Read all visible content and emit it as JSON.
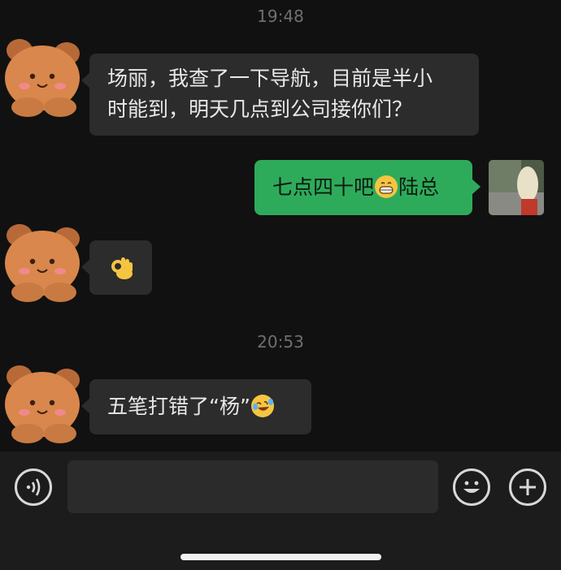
{
  "timestamps": [
    "19:48",
    "20:53"
  ],
  "messages": [
    {
      "side": "in",
      "lines": [
        "场丽，我查了一下导航，目前是半小",
        "时能到，明天几点到公司接你们？"
      ]
    },
    {
      "side": "out",
      "text_before": "七点四十吧",
      "emoji": "grinning-face",
      "text_after": "陆总"
    },
    {
      "side": "in",
      "emoji": "ok-hand"
    },
    {
      "side": "in",
      "text_before": "五笔打错了“杨”",
      "emoji": "rolling-laughing-face"
    }
  ],
  "icons": {
    "voice": "voice-icon",
    "emoji_picker": "smiley-icon",
    "more": "plus-icon",
    "avatar_contact": "teddy-bear-avatar",
    "avatar_self": "photo-avatar"
  },
  "input": {
    "value": ""
  },
  "colors": {
    "background": "#111111",
    "incoming_bubble": "#2c2c2c",
    "outgoing_bubble": "#2eab5a",
    "bar": "#1c1c1c"
  }
}
